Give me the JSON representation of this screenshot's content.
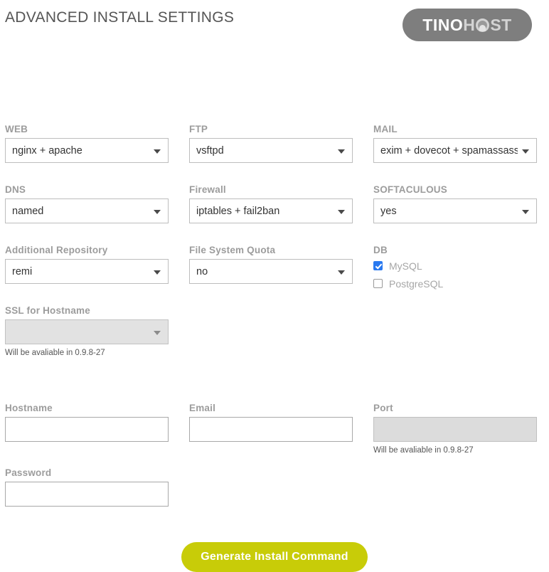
{
  "header": {
    "title": "ADVANCED INSTALL SETTINGS",
    "logo": {
      "part1": "TINO",
      "part2": "H",
      "globe_icon": "globe-icon",
      "part3": "ST"
    }
  },
  "colors": {
    "accent_button": "#c8cc08",
    "checkbox_checked": "#2979f0",
    "logo_background": "#7e7e7e",
    "label_text": "#9c9c9c"
  },
  "fields": {
    "web": {
      "label": "WEB",
      "value": "nginx + apache"
    },
    "ftp": {
      "label": "FTP",
      "value": "vsftpd"
    },
    "mail": {
      "label": "MAIL",
      "value": "exim + dovecot + spamassassin"
    },
    "dns": {
      "label": "DNS",
      "value": "named"
    },
    "firewall": {
      "label": "Firewall",
      "value": "iptables + fail2ban"
    },
    "softaculous": {
      "label": "SOFTACULOUS",
      "value": "yes"
    },
    "additional_repository": {
      "label": "Additional Repository",
      "value": "remi"
    },
    "file_system_quota": {
      "label": "File System Quota",
      "value": "no"
    },
    "db": {
      "label": "DB",
      "options": [
        {
          "label": "MySQL",
          "checked": true
        },
        {
          "label": "PostgreSQL",
          "checked": false
        }
      ]
    },
    "ssl_for_hostname": {
      "label": "SSL for Hostname",
      "value": "",
      "disabled": true,
      "note": "Will be avaliable in 0.9.8-27"
    },
    "hostname": {
      "label": "Hostname",
      "value": "",
      "placeholder": ""
    },
    "email": {
      "label": "Email",
      "value": "",
      "placeholder": ""
    },
    "port": {
      "label": "Port",
      "value": "",
      "placeholder": "",
      "disabled": true,
      "note": "Will be avaliable in 0.9.8-27"
    },
    "password": {
      "label": "Password",
      "value": "",
      "placeholder": ""
    }
  },
  "actions": {
    "generate_label": "Generate Install Command"
  }
}
